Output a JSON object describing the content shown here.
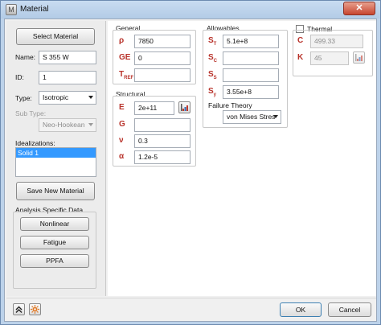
{
  "window": {
    "title": "Material",
    "close_glyph": "✕",
    "app_icon": "M"
  },
  "left": {
    "select_material": "Select Material",
    "name_label": "Name:",
    "name_value": "S 355 W",
    "id_label": "ID:",
    "id_value": "1",
    "type_label": "Type:",
    "type_value": "Isotropic",
    "subtype_label": "Sub Type:",
    "subtype_value": "Neo-Hookean",
    "idealizations_label": "Idealizations:",
    "idealizations": [
      "Solid 1"
    ],
    "save_new": "Save New Material",
    "analysis_label": "Analysis Specific Data",
    "nonlinear": "Nonlinear",
    "fatigue": "Fatigue",
    "ppfa": "PPFA"
  },
  "general": {
    "title": "General",
    "rho_sym": "ρ",
    "rho_value": "7850",
    "ge_sym": "GE",
    "ge_value": "0",
    "tref_sym": "T",
    "tref_sub": "REF",
    "tref_value": ""
  },
  "structural": {
    "title": "Structural",
    "e_sym": "E",
    "e_value": "2e+11",
    "g_sym": "G",
    "g_value": "",
    "nu_sym": "ν",
    "nu_value": "0.3",
    "alpha_sym": "α",
    "alpha_value": "1.2e-5"
  },
  "allowables": {
    "title": "Allowables",
    "st_sym": "S",
    "st_sub": "T",
    "st_value": "5.1e+8",
    "sc_sym": "S",
    "sc_sub": "C",
    "sc_value": "",
    "ss_sym": "S",
    "ss_sub": "S",
    "ss_value": "",
    "sy_sym": "S",
    "sy_sub": "y",
    "sy_value": "3.55e+8",
    "failure_label": "Failure Theory",
    "failure_value": "von Mises Stres"
  },
  "thermal": {
    "label": "Thermal",
    "c_sym": "C",
    "c_value": "499.33",
    "k_sym": "K",
    "k_value": "45"
  },
  "bottom": {
    "ok": "OK",
    "cancel": "Cancel"
  },
  "colors": {
    "symbol": "#b8322a",
    "selection": "#3399ff"
  }
}
